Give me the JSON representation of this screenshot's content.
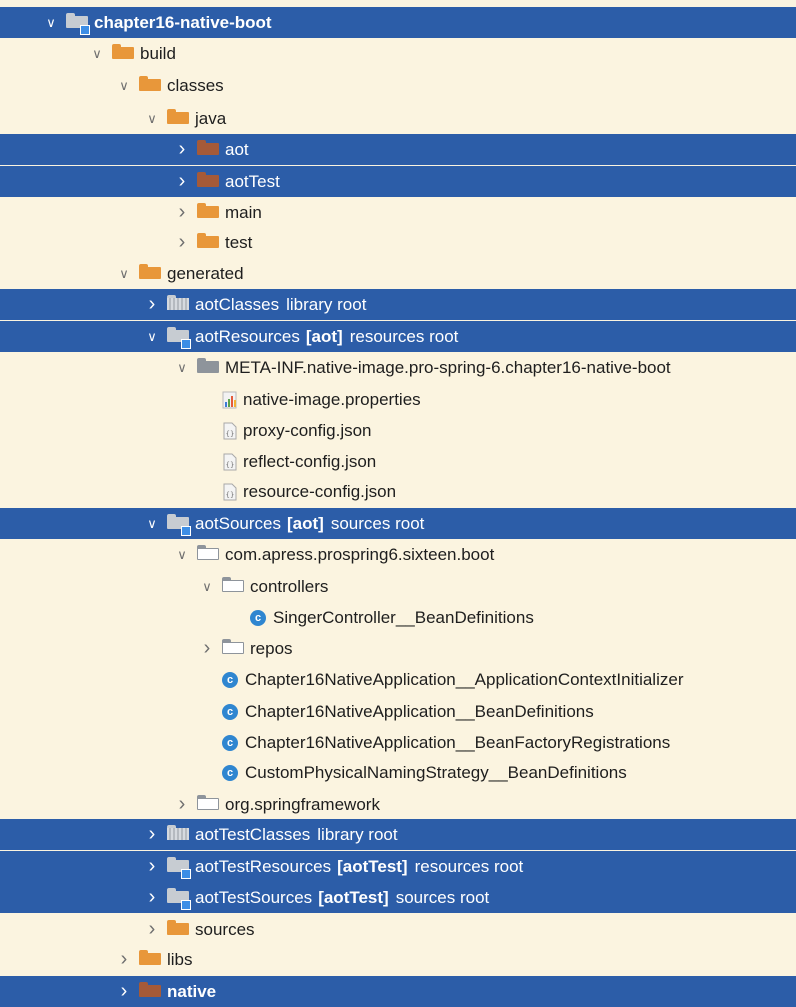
{
  "colors": {
    "background": "#fbf4e0",
    "selection": "#2c5da8",
    "folder_orange": "#e8973a",
    "folder_brown": "#a55a38",
    "folder_gray": "#8e949b",
    "class_icon": "#2f86d0"
  },
  "tree": [
    {
      "label": "chapter16-native-boot",
      "depth": 0,
      "state": "expanded",
      "icon": "module-folder-icon",
      "selected": true,
      "bold": true
    },
    {
      "label": "build",
      "depth": 1,
      "state": "expanded",
      "icon": "folder-orange-icon"
    },
    {
      "label": "classes",
      "depth": 2,
      "state": "expanded",
      "icon": "folder-orange-icon"
    },
    {
      "label": "java",
      "depth": 3,
      "state": "expanded",
      "icon": "folder-orange-icon"
    },
    {
      "label": "aot",
      "depth": 4,
      "state": "collapsed",
      "icon": "folder-brown-icon",
      "selected": true
    },
    {
      "label": "aotTest",
      "depth": 4,
      "state": "collapsed",
      "icon": "folder-brown-icon",
      "selected": true
    },
    {
      "label": "main",
      "depth": 4,
      "state": "collapsed",
      "icon": "folder-orange-icon"
    },
    {
      "label": "test",
      "depth": 4,
      "state": "collapsed",
      "icon": "folder-orange-icon"
    },
    {
      "label": "generated",
      "depth": 2,
      "state": "expanded",
      "icon": "folder-orange-icon"
    },
    {
      "label": "aotClasses",
      "suffix": "library root",
      "depth": 3,
      "state": "collapsed",
      "icon": "library-folder-icon",
      "selected": true
    },
    {
      "label": "aotResources",
      "badge": "[aot]",
      "suffix": "resources root",
      "depth": 3,
      "state": "expanded",
      "icon": "resources-root-icon",
      "selected": true
    },
    {
      "label": "META-INF.native-image.pro-spring-6.chapter16-native-boot",
      "depth": 4,
      "state": "expanded",
      "icon": "folder-gray-icon"
    },
    {
      "label": "native-image.properties",
      "depth": 5,
      "state": "none",
      "icon": "properties-file-icon"
    },
    {
      "label": "proxy-config.json",
      "depth": 5,
      "state": "none",
      "icon": "json-file-icon"
    },
    {
      "label": "reflect-config.json",
      "depth": 5,
      "state": "none",
      "icon": "json-file-icon"
    },
    {
      "label": "resource-config.json",
      "depth": 5,
      "state": "none",
      "icon": "json-file-icon"
    },
    {
      "label": "aotSources",
      "badge": "[aot]",
      "suffix": "sources root",
      "depth": 3,
      "state": "expanded",
      "icon": "sources-root-icon",
      "selected": true
    },
    {
      "label": "com.apress.prospring6.sixteen.boot",
      "depth": 4,
      "state": "expanded",
      "icon": "package-icon"
    },
    {
      "label": "controllers",
      "depth": 5,
      "state": "expanded",
      "icon": "package-icon"
    },
    {
      "label": "SingerController__BeanDefinitions",
      "depth": 6,
      "state": "none",
      "icon": "class-icon"
    },
    {
      "label": "repos",
      "depth": 5,
      "state": "collapsed",
      "icon": "package-icon"
    },
    {
      "label": "Chapter16NativeApplication__ApplicationContextInitializer",
      "depth": 5,
      "state": "none",
      "icon": "class-icon"
    },
    {
      "label": "Chapter16NativeApplication__BeanDefinitions",
      "depth": 5,
      "state": "none",
      "icon": "class-icon"
    },
    {
      "label": "Chapter16NativeApplication__BeanFactoryRegistrations",
      "depth": 5,
      "state": "none",
      "icon": "class-icon"
    },
    {
      "label": "CustomPhysicalNamingStrategy__BeanDefinitions",
      "depth": 5,
      "state": "none",
      "icon": "class-icon"
    },
    {
      "label": "org.springframework",
      "depth": 4,
      "state": "collapsed",
      "icon": "package-icon"
    },
    {
      "label": "aotTestClasses",
      "suffix": "library root",
      "depth": 3,
      "state": "collapsed",
      "icon": "library-folder-icon",
      "selected": true
    },
    {
      "label": "aotTestResources",
      "badge": "[aotTest]",
      "suffix": "resources root",
      "depth": 3,
      "state": "collapsed",
      "icon": "resources-root-icon",
      "selected": true
    },
    {
      "label": "aotTestSources",
      "badge": "[aotTest]",
      "suffix": "sources root",
      "depth": 3,
      "state": "collapsed",
      "icon": "sources-root-icon",
      "selected": true
    },
    {
      "label": "sources",
      "depth": 3,
      "state": "collapsed",
      "icon": "folder-orange-icon"
    },
    {
      "label": "libs",
      "depth": 2,
      "state": "collapsed",
      "icon": "folder-orange-icon"
    },
    {
      "label": "native",
      "depth": 2,
      "state": "collapsed",
      "icon": "folder-brown-icon",
      "selected": true,
      "bold": true
    }
  ]
}
